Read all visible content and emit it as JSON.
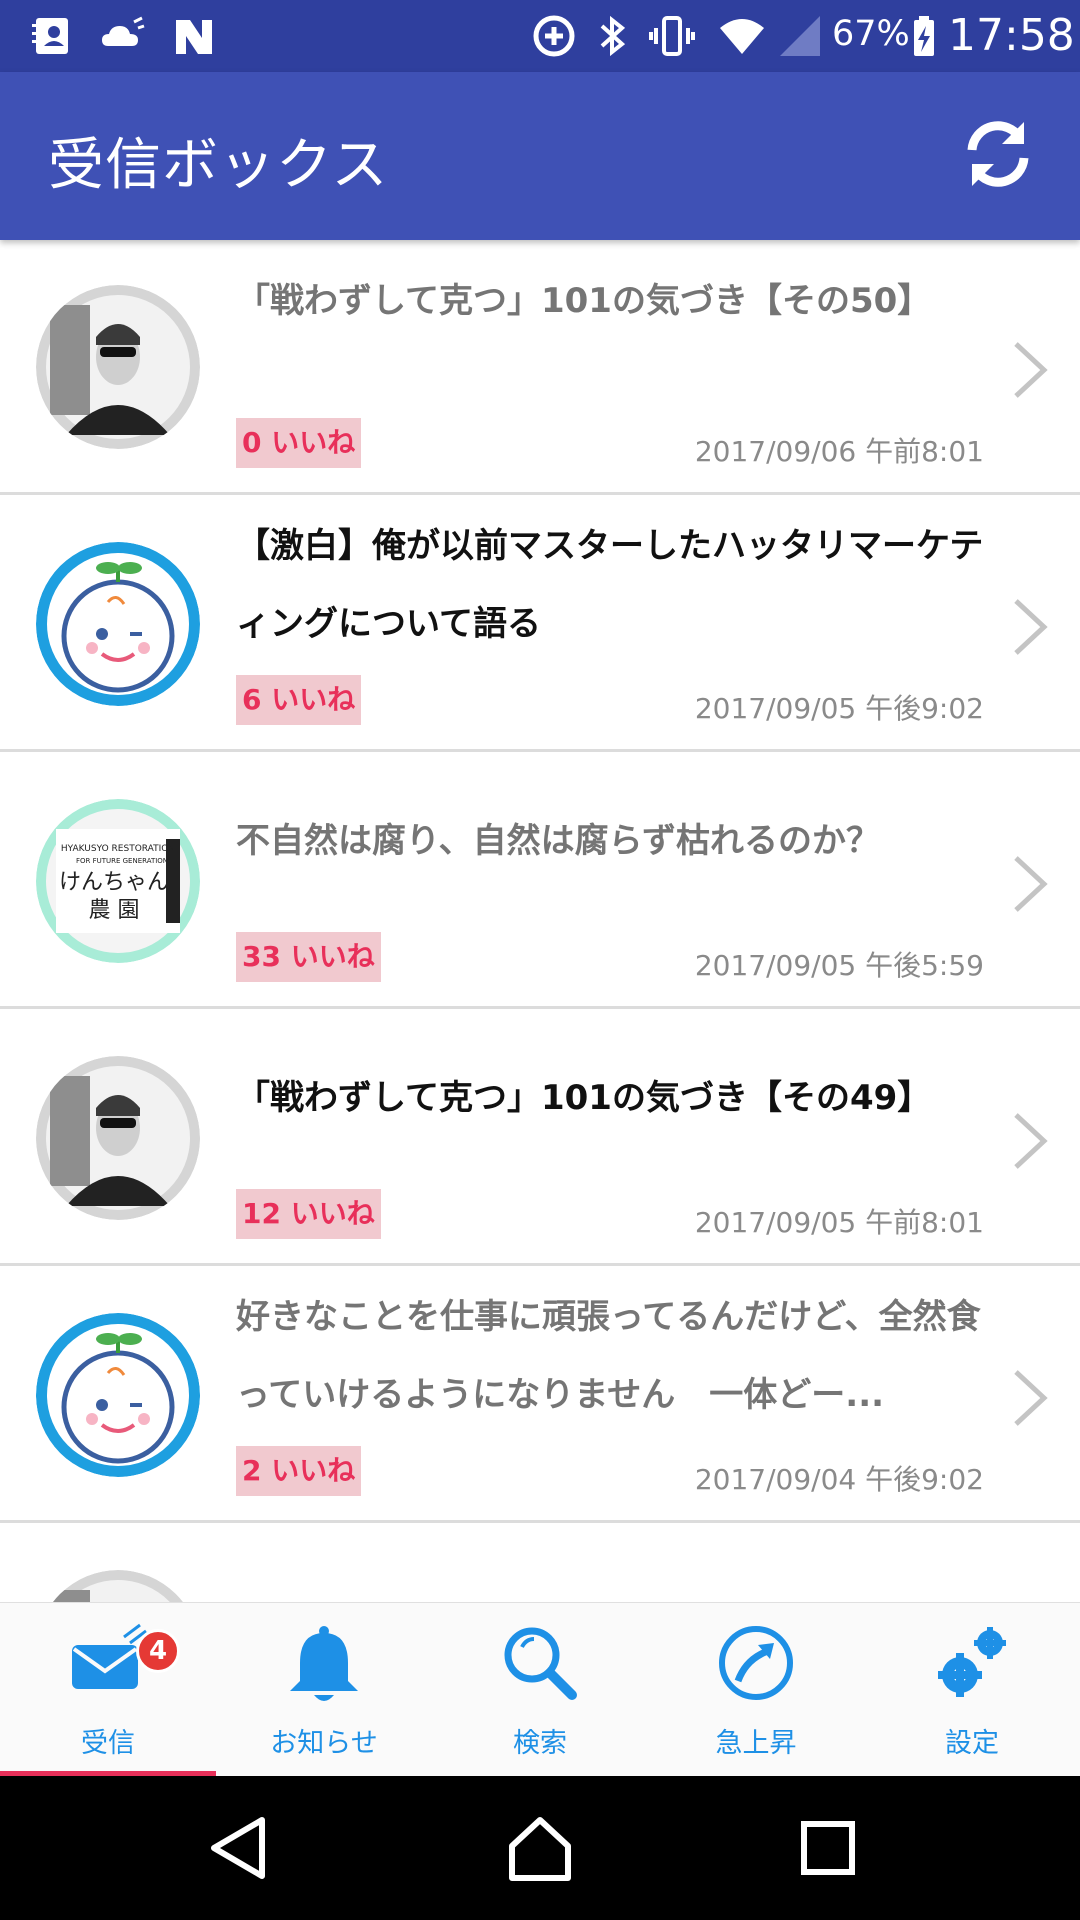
{
  "status_bar": {
    "battery": "67%",
    "time": "17:58"
  },
  "app_bar": {
    "title": "受信ボックス",
    "refresh_icon": "refresh-icon"
  },
  "messages": [
    {
      "title": "「戦わずして克つ」101の気づき【その50】",
      "likes": "0 いいね",
      "date": "2017/09/06 午前8:01",
      "read": true,
      "avatar": "man-sunglasses"
    },
    {
      "title": "【激白】俺が以前マスターしたハッタリマーケティングについて語る",
      "likes": "6 いいね",
      "date": "2017/09/05 午後9:02",
      "read": false,
      "avatar": "sprout-character"
    },
    {
      "title": "不自然は腐り、自然は腐らず枯れるのか？",
      "likes": "33 いいね",
      "date": "2017/09/05 午後5:59",
      "read": true,
      "avatar": "kenchan-farm"
    },
    {
      "title": "「戦わずして克つ」101の気づき【その49】",
      "likes": "12 いいね",
      "date": "2017/09/05 午前8:01",
      "read": false,
      "avatar": "man-sunglasses"
    },
    {
      "title": "好きなことを仕事に頑張ってるんだけど、全然食っていけるようになりません　一体どー...",
      "likes": "2 いいね",
      "date": "2017/09/04 午後9:02",
      "read": true,
      "avatar": "sprout-character"
    }
  ],
  "avatar_texts": {
    "kenchan_line1": "HYAKUSYO RESTORATION",
    "kenchan_line2": "FOR FUTURE GENERATION",
    "kenchan_name": "けんちゃん",
    "kenchan_farm": "農 園"
  },
  "bottom_nav": {
    "items": [
      {
        "label": "受信",
        "icon": "mail-icon"
      },
      {
        "label": "お知らせ",
        "icon": "bell-icon"
      },
      {
        "label": "検索",
        "icon": "search-icon"
      },
      {
        "label": "急上昇",
        "icon": "trending-icon"
      },
      {
        "label": "設定",
        "icon": "gears-icon"
      }
    ],
    "inbox_badge": "4",
    "selected_index": 0
  },
  "colors": {
    "status_bar": "#2f3f9e",
    "app_bar": "#3f51b5",
    "accent_pink": "#e8305a",
    "nav_blue": "#1e90e6",
    "likes_bg": "#f1c9cf"
  }
}
